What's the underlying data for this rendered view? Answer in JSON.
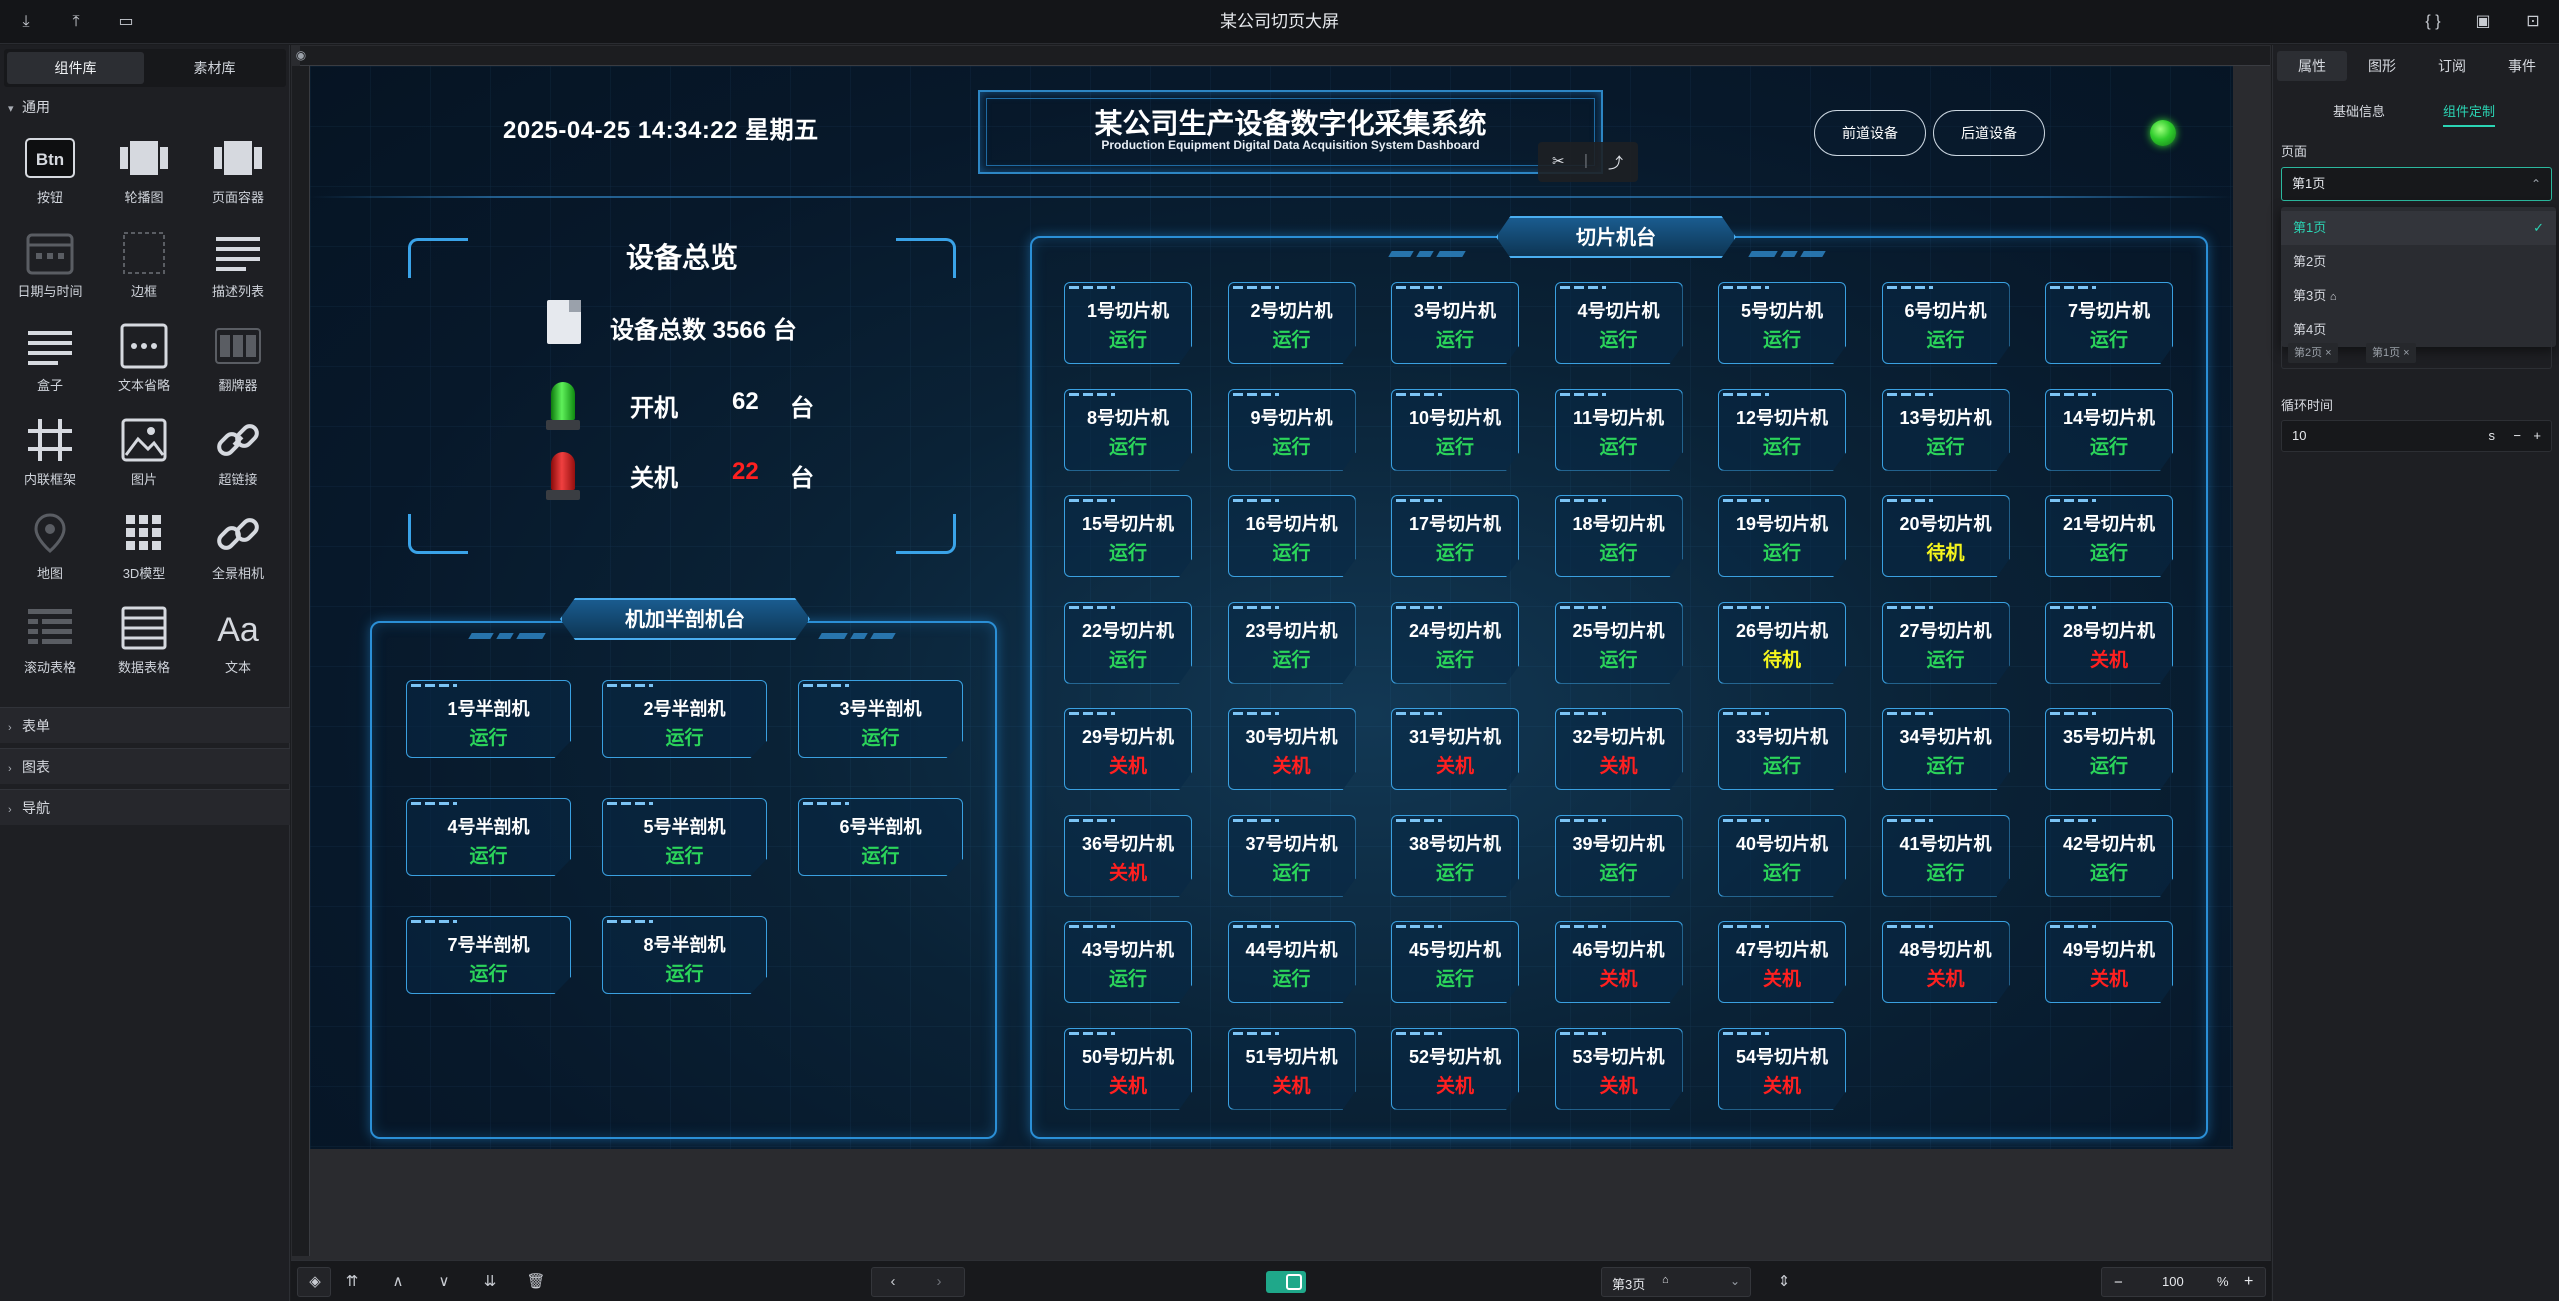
{
  "app": {
    "title": "某公司切页大屏"
  },
  "left_panel": {
    "tabs": [
      "组件库",
      "素材库"
    ],
    "open_category": "通用",
    "components": [
      "按钮",
      "轮播图",
      "页面容器",
      "日期与时间",
      "边框",
      "描述列表",
      "盒子",
      "文本省略",
      "翻牌器",
      "内联框架",
      "图片",
      "超链接",
      "地图",
      "3D模型",
      "全景相机",
      "滚动表格",
      "数据表格",
      "文本"
    ],
    "btn_icon_text": "Btn",
    "text_icon_text": "Aa",
    "collapsed_categories": [
      "表单",
      "图表",
      "导航"
    ]
  },
  "dashboard": {
    "datetime": "2025-04-25 14:34:22 星期五",
    "title_cn": "某公司生产设备数字化采集系统",
    "title_en": "Production Equipment Digital Data Acquisition System Dashboard",
    "nav_prev": "前道设备",
    "nav_next": "后道设备",
    "overview": {
      "title": "设备总览",
      "total_label": "设备总数",
      "total_value": "3566",
      "unit": "台",
      "on_label": "开机",
      "on_value": "62",
      "off_label": "关机",
      "off_value": "22"
    },
    "half_section": {
      "title": "机加半剖机台",
      "machines": [
        {
          "name": "1号半剖机",
          "status": "运行"
        },
        {
          "name": "2号半剖机",
          "status": "运行"
        },
        {
          "name": "3号半剖机",
          "status": "运行"
        },
        {
          "name": "4号半剖机",
          "status": "运行"
        },
        {
          "name": "5号半剖机",
          "status": "运行"
        },
        {
          "name": "6号半剖机",
          "status": "运行"
        },
        {
          "name": "7号半剖机",
          "status": "运行"
        },
        {
          "name": "8号半剖机",
          "status": "运行"
        }
      ]
    },
    "slice_section": {
      "title": "切片机台",
      "machines": [
        {
          "name": "1号切片机",
          "status": "运行"
        },
        {
          "name": "2号切片机",
          "status": "运行"
        },
        {
          "name": "3号切片机",
          "status": "运行"
        },
        {
          "name": "4号切片机",
          "status": "运行"
        },
        {
          "name": "5号切片机",
          "status": "运行"
        },
        {
          "name": "6号切片机",
          "status": "运行"
        },
        {
          "name": "7号切片机",
          "status": "运行"
        },
        {
          "name": "8号切片机",
          "status": "运行"
        },
        {
          "name": "9号切片机",
          "status": "运行"
        },
        {
          "name": "10号切片机",
          "status": "运行"
        },
        {
          "name": "11号切片机",
          "status": "运行"
        },
        {
          "name": "12号切片机",
          "status": "运行"
        },
        {
          "name": "13号切片机",
          "status": "运行"
        },
        {
          "name": "14号切片机",
          "status": "运行"
        },
        {
          "name": "15号切片机",
          "status": "运行"
        },
        {
          "name": "16号切片机",
          "status": "运行"
        },
        {
          "name": "17号切片机",
          "status": "运行"
        },
        {
          "name": "18号切片机",
          "status": "运行"
        },
        {
          "name": "19号切片机",
          "status": "运行"
        },
        {
          "name": "20号切片机",
          "status": "待机"
        },
        {
          "name": "21号切片机",
          "status": "运行"
        },
        {
          "name": "22号切片机",
          "status": "运行"
        },
        {
          "name": "23号切片机",
          "status": "运行"
        },
        {
          "name": "24号切片机",
          "status": "运行"
        },
        {
          "name": "25号切片机",
          "status": "运行"
        },
        {
          "name": "26号切片机",
          "status": "待机"
        },
        {
          "name": "27号切片机",
          "status": "运行"
        },
        {
          "name": "28号切片机",
          "status": "关机"
        },
        {
          "name": "29号切片机",
          "status": "关机"
        },
        {
          "name": "30号切片机",
          "status": "关机"
        },
        {
          "name": "31号切片机",
          "status": "关机"
        },
        {
          "name": "32号切片机",
          "status": "关机"
        },
        {
          "name": "33号切片机",
          "status": "运行"
        },
        {
          "name": "34号切片机",
          "status": "运行"
        },
        {
          "name": "35号切片机",
          "status": "运行"
        },
        {
          "name": "36号切片机",
          "status": "关机"
        },
        {
          "name": "37号切片机",
          "status": "运行"
        },
        {
          "name": "38号切片机",
          "status": "运行"
        },
        {
          "name": "39号切片机",
          "status": "运行"
        },
        {
          "name": "40号切片机",
          "status": "运行"
        },
        {
          "name": "41号切片机",
          "status": "运行"
        },
        {
          "name": "42号切片机",
          "status": "运行"
        },
        {
          "name": "43号切片机",
          "status": "运行"
        },
        {
          "name": "44号切片机",
          "status": "运行"
        },
        {
          "name": "45号切片机",
          "status": "运行"
        },
        {
          "name": "46号切片机",
          "status": "关机"
        },
        {
          "name": "47号切片机",
          "status": "关机"
        },
        {
          "name": "48号切片机",
          "status": "关机"
        },
        {
          "name": "49号切片机",
          "status": "关机"
        },
        {
          "name": "50号切片机",
          "status": "关机"
        },
        {
          "name": "51号切片机",
          "status": "关机"
        },
        {
          "name": "52号切片机",
          "status": "关机"
        },
        {
          "name": "53号切片机",
          "status": "关机"
        },
        {
          "name": "54号切片机",
          "status": "关机"
        }
      ]
    },
    "colors": {
      "running": "#2bd45a",
      "standby": "#f5f51d",
      "off": "#ff2020"
    }
  },
  "right_panel": {
    "tabs": [
      "属性",
      "图形",
      "订阅",
      "事件"
    ],
    "subtabs": [
      "基础信息",
      "组件定制"
    ],
    "page_label": "页面",
    "page_selected": "第1页",
    "page_options": [
      "第1页",
      "第2页",
      "第3页",
      "第4页"
    ],
    "tags": [
      "第2页",
      "第1页"
    ],
    "loop_label": "循环时间",
    "loop_value": "10",
    "loop_unit": "s"
  },
  "bottom_bar": {
    "page_select": "第3页",
    "zoom": "100",
    "zoom_unit": "%"
  }
}
